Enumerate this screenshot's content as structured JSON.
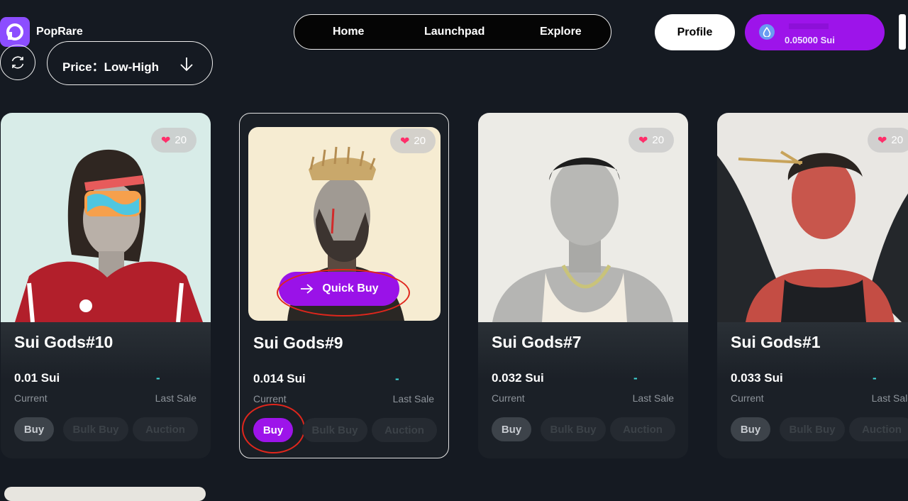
{
  "app": {
    "name": "PopRare"
  },
  "nav": {
    "home": "Home",
    "launchpad": "Launchpad",
    "explore": "Explore"
  },
  "header": {
    "profile_label": "Profile",
    "wallet_balance": "0.05000 Sui"
  },
  "filter": {
    "sort_label": "Price：Low-High"
  },
  "cards": [
    {
      "name": "Sui Gods#10",
      "likes": "20",
      "price": "0.01 Sui",
      "price_caption": "Current",
      "last_sale": "-",
      "last_sale_caption": "Last Sale",
      "buy": "Buy",
      "bulk_buy": "Bulk Buy",
      "auction": "Auction"
    },
    {
      "name": "Sui Gods#9",
      "likes": "20",
      "price": "0.014 Sui",
      "price_caption": "Current",
      "last_sale": "-",
      "last_sale_caption": "Last Sale",
      "buy": "Buy",
      "bulk_buy": "Bulk Buy",
      "auction": "Auction",
      "quick_buy": "Quick Buy"
    },
    {
      "name": "Sui Gods#7",
      "likes": "20",
      "price": "0.032 Sui",
      "price_caption": "Current",
      "last_sale": "-",
      "last_sale_caption": "Last Sale",
      "buy": "Buy",
      "bulk_buy": "Bulk Buy",
      "auction": "Auction"
    },
    {
      "name": "Sui Gods#1",
      "likes": "20",
      "price": "0.033 Sui",
      "price_caption": "Current",
      "last_sale": "-",
      "last_sale_caption": "Last Sale",
      "buy": "Buy",
      "bulk_buy": "Bulk Buy",
      "auction": "Auction"
    }
  ],
  "colors": {
    "accent": "#9d14ea",
    "background": "#151a22",
    "card": "#1b2027",
    "highlight_ring": "#e0261c"
  },
  "icons": {
    "logo": "poprare-logo-icon",
    "wallet": "sui-drop-icon",
    "refresh": "refresh-icon",
    "sort": "arrow-down-icon",
    "like": "heart-icon",
    "quick_buy": "send-arrow-icon"
  }
}
